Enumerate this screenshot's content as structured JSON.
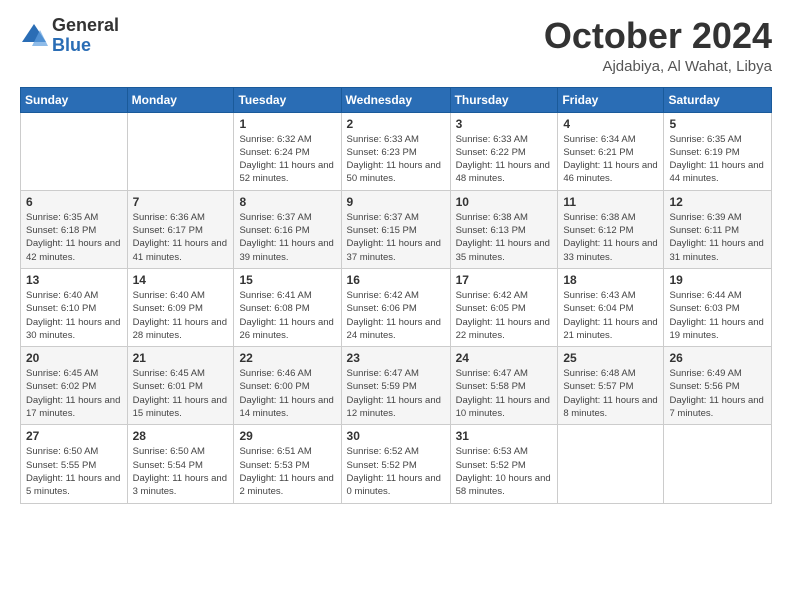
{
  "logo": {
    "general": "General",
    "blue": "Blue"
  },
  "title": "October 2024",
  "location": "Ajdabiya, Al Wahat, Libya",
  "headers": [
    "Sunday",
    "Monday",
    "Tuesday",
    "Wednesday",
    "Thursday",
    "Friday",
    "Saturday"
  ],
  "weeks": [
    [
      {
        "day": "",
        "info": ""
      },
      {
        "day": "",
        "info": ""
      },
      {
        "day": "1",
        "info": "Sunrise: 6:32 AM\nSunset: 6:24 PM\nDaylight: 11 hours and 52 minutes."
      },
      {
        "day": "2",
        "info": "Sunrise: 6:33 AM\nSunset: 6:23 PM\nDaylight: 11 hours and 50 minutes."
      },
      {
        "day": "3",
        "info": "Sunrise: 6:33 AM\nSunset: 6:22 PM\nDaylight: 11 hours and 48 minutes."
      },
      {
        "day": "4",
        "info": "Sunrise: 6:34 AM\nSunset: 6:21 PM\nDaylight: 11 hours and 46 minutes."
      },
      {
        "day": "5",
        "info": "Sunrise: 6:35 AM\nSunset: 6:19 PM\nDaylight: 11 hours and 44 minutes."
      }
    ],
    [
      {
        "day": "6",
        "info": "Sunrise: 6:35 AM\nSunset: 6:18 PM\nDaylight: 11 hours and 42 minutes."
      },
      {
        "day": "7",
        "info": "Sunrise: 6:36 AM\nSunset: 6:17 PM\nDaylight: 11 hours and 41 minutes."
      },
      {
        "day": "8",
        "info": "Sunrise: 6:37 AM\nSunset: 6:16 PM\nDaylight: 11 hours and 39 minutes."
      },
      {
        "day": "9",
        "info": "Sunrise: 6:37 AM\nSunset: 6:15 PM\nDaylight: 11 hours and 37 minutes."
      },
      {
        "day": "10",
        "info": "Sunrise: 6:38 AM\nSunset: 6:13 PM\nDaylight: 11 hours and 35 minutes."
      },
      {
        "day": "11",
        "info": "Sunrise: 6:38 AM\nSunset: 6:12 PM\nDaylight: 11 hours and 33 minutes."
      },
      {
        "day": "12",
        "info": "Sunrise: 6:39 AM\nSunset: 6:11 PM\nDaylight: 11 hours and 31 minutes."
      }
    ],
    [
      {
        "day": "13",
        "info": "Sunrise: 6:40 AM\nSunset: 6:10 PM\nDaylight: 11 hours and 30 minutes."
      },
      {
        "day": "14",
        "info": "Sunrise: 6:40 AM\nSunset: 6:09 PM\nDaylight: 11 hours and 28 minutes."
      },
      {
        "day": "15",
        "info": "Sunrise: 6:41 AM\nSunset: 6:08 PM\nDaylight: 11 hours and 26 minutes."
      },
      {
        "day": "16",
        "info": "Sunrise: 6:42 AM\nSunset: 6:06 PM\nDaylight: 11 hours and 24 minutes."
      },
      {
        "day": "17",
        "info": "Sunrise: 6:42 AM\nSunset: 6:05 PM\nDaylight: 11 hours and 22 minutes."
      },
      {
        "day": "18",
        "info": "Sunrise: 6:43 AM\nSunset: 6:04 PM\nDaylight: 11 hours and 21 minutes."
      },
      {
        "day": "19",
        "info": "Sunrise: 6:44 AM\nSunset: 6:03 PM\nDaylight: 11 hours and 19 minutes."
      }
    ],
    [
      {
        "day": "20",
        "info": "Sunrise: 6:45 AM\nSunset: 6:02 PM\nDaylight: 11 hours and 17 minutes."
      },
      {
        "day": "21",
        "info": "Sunrise: 6:45 AM\nSunset: 6:01 PM\nDaylight: 11 hours and 15 minutes."
      },
      {
        "day": "22",
        "info": "Sunrise: 6:46 AM\nSunset: 6:00 PM\nDaylight: 11 hours and 14 minutes."
      },
      {
        "day": "23",
        "info": "Sunrise: 6:47 AM\nSunset: 5:59 PM\nDaylight: 11 hours and 12 minutes."
      },
      {
        "day": "24",
        "info": "Sunrise: 6:47 AM\nSunset: 5:58 PM\nDaylight: 11 hours and 10 minutes."
      },
      {
        "day": "25",
        "info": "Sunrise: 6:48 AM\nSunset: 5:57 PM\nDaylight: 11 hours and 8 minutes."
      },
      {
        "day": "26",
        "info": "Sunrise: 6:49 AM\nSunset: 5:56 PM\nDaylight: 11 hours and 7 minutes."
      }
    ],
    [
      {
        "day": "27",
        "info": "Sunrise: 6:50 AM\nSunset: 5:55 PM\nDaylight: 11 hours and 5 minutes."
      },
      {
        "day": "28",
        "info": "Sunrise: 6:50 AM\nSunset: 5:54 PM\nDaylight: 11 hours and 3 minutes."
      },
      {
        "day": "29",
        "info": "Sunrise: 6:51 AM\nSunset: 5:53 PM\nDaylight: 11 hours and 2 minutes."
      },
      {
        "day": "30",
        "info": "Sunrise: 6:52 AM\nSunset: 5:52 PM\nDaylight: 11 hours and 0 minutes."
      },
      {
        "day": "31",
        "info": "Sunrise: 6:53 AM\nSunset: 5:52 PM\nDaylight: 10 hours and 58 minutes."
      },
      {
        "day": "",
        "info": ""
      },
      {
        "day": "",
        "info": ""
      }
    ]
  ]
}
